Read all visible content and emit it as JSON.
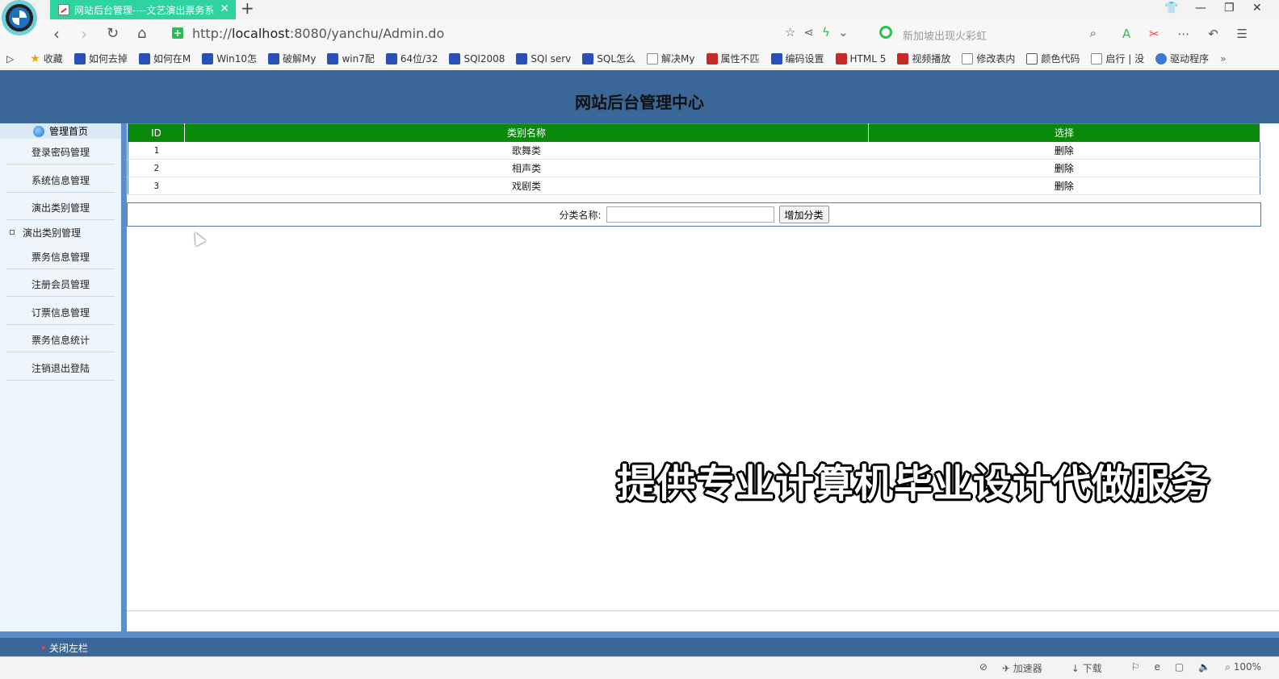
{
  "browser": {
    "tab_title": "网站后台管理----文艺演出票务系",
    "url_prefix": "http://",
    "url_host": "localhost",
    "url_rest": ":8080/yanchu/Admin.do",
    "search_placeholder": "新加坡出现火彩虹",
    "bookmarks": [
      {
        "label": "收藏",
        "icon": "star-icon"
      },
      {
        "label": "如何去掉",
        "icon": "baidu-paw-icon"
      },
      {
        "label": "如何在M",
        "icon": "baidu-paw-icon"
      },
      {
        "label": "Win10怎",
        "icon": "baidu-paw-icon"
      },
      {
        "label": "破解My",
        "icon": "baidu-paw-icon"
      },
      {
        "label": "win7配",
        "icon": "baidu-paw-icon"
      },
      {
        "label": "64位/32",
        "icon": "baidu-paw-icon"
      },
      {
        "label": "SQl2008",
        "icon": "baidu-paw-icon"
      },
      {
        "label": "SQl serv",
        "icon": "baidu-paw-icon"
      },
      {
        "label": "SQL怎么",
        "icon": "baidu-paw-icon"
      },
      {
        "label": "解决My",
        "icon": "page-icon"
      },
      {
        "label": "属性不匹",
        "icon": "csdn-icon"
      },
      {
        "label": "编码设置",
        "icon": "baidu-paw-icon"
      },
      {
        "label": "HTML 5",
        "icon": "w3-icon"
      },
      {
        "label": "视频播放",
        "icon": "csdn-icon"
      },
      {
        "label": "修改表内",
        "icon": "document-icon"
      },
      {
        "label": "颜色代码",
        "icon": "code-icon"
      },
      {
        "label": "启行 | 没",
        "icon": "document-icon"
      },
      {
        "label": "驱动程序",
        "icon": "globe-icon"
      }
    ],
    "status": {
      "accelerator": "加速器",
      "download": "下载",
      "zoom": "100%"
    }
  },
  "page": {
    "title": "网站后台管理中心",
    "sidebar": {
      "home": "管理首页",
      "items": [
        "登录密码管理",
        "系统信息管理",
        "演出类别管理"
      ],
      "sub_item": "演出类别管理",
      "items_after": [
        "票务信息管理",
        "注册会员管理",
        "订票信息管理",
        "票务信息统计",
        "注销退出登陆"
      ]
    },
    "table": {
      "headers": [
        "ID",
        "类别名称",
        "选择"
      ],
      "rows": [
        {
          "id": "1",
          "name": "歌舞类",
          "action": "删除"
        },
        {
          "id": "2",
          "name": "相声类",
          "action": "删除"
        },
        {
          "id": "3",
          "name": "戏剧类",
          "action": "删除"
        }
      ]
    },
    "add_form": {
      "label": "分类名称:",
      "value": "",
      "button": "增加分类"
    },
    "close_left": "关闭左栏"
  },
  "overlay": {
    "watermark": "提供专业计算机毕业设计代做服务"
  },
  "colors": {
    "header_bg": "#3a6797",
    "table_header_bg": "#0a8a0a",
    "tab_bg": "#2fd3a0",
    "sidebar_bg": "#eef5fb"
  }
}
